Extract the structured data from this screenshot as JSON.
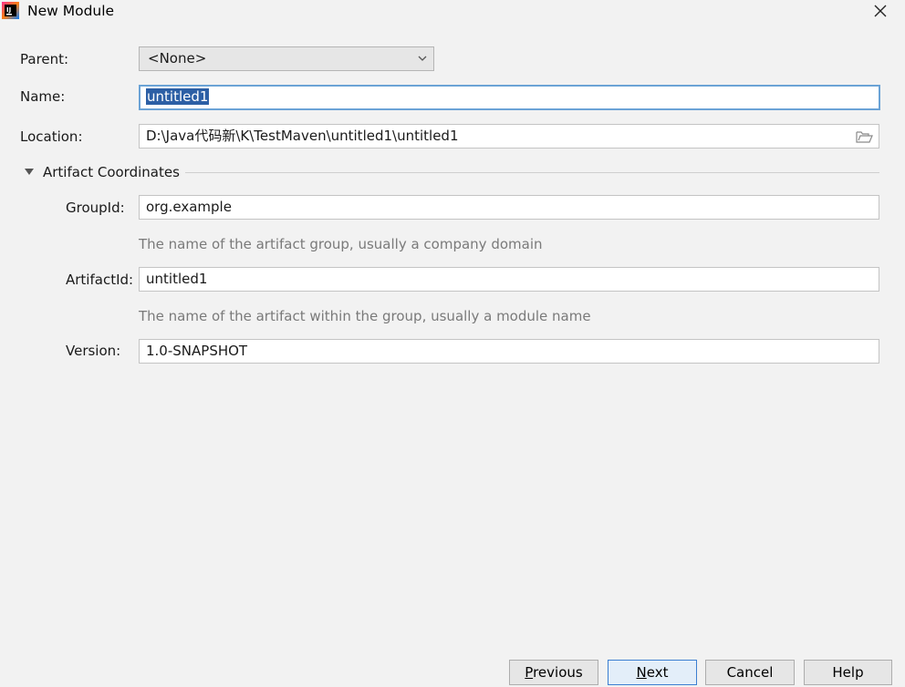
{
  "window": {
    "title": "New Module",
    "app_icon": "intellij-idea-icon",
    "close_icon": "close-icon"
  },
  "form": {
    "parent": {
      "label": "Parent:",
      "value": "<None>"
    },
    "name": {
      "label": "Name:",
      "value": "untitled1"
    },
    "location": {
      "label": "Location:",
      "value": "D:\\Java代码新\\K\\TestMaven\\untitled1\\untitled1",
      "browse_icon": "folder-icon"
    }
  },
  "artifact": {
    "section_title": "Artifact Coordinates",
    "expanded": true,
    "group_id": {
      "label": "GroupId:",
      "value": "org.example",
      "hint": "The name of the artifact group, usually a company domain"
    },
    "artifact_id": {
      "label": "ArtifactId:",
      "value": "untitled1",
      "hint": "The name of the artifact within the group, usually a module name"
    },
    "version": {
      "label": "Version:",
      "value": "1.0-SNAPSHOT"
    }
  },
  "buttons": {
    "previous_mnemonic": "P",
    "previous_rest": "revious",
    "next_mnemonic": "N",
    "next_rest": "ext",
    "cancel": "Cancel",
    "help": "Help"
  },
  "colors": {
    "background": "#f2f2f2",
    "selection": "#2c5fa5",
    "focus_border": "#6ba3d6",
    "default_button_border": "#3c7fd1"
  }
}
